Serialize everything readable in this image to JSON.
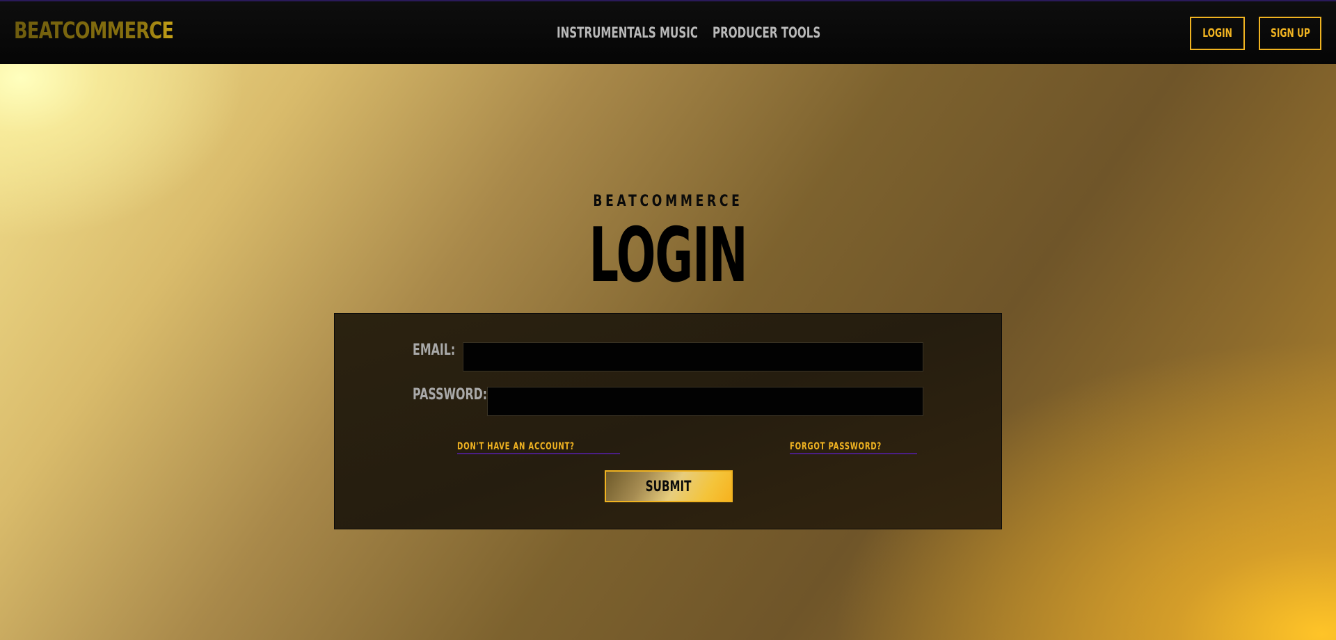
{
  "navbar": {
    "logo": "BEATCOMMERCE",
    "links": [
      "INSTRUMENTALS",
      "MUSIC",
      "PRODUCER TOOLS"
    ],
    "login_label": "LOGIN",
    "signup_label": "SIGN UP"
  },
  "hero": {
    "brand": "BEATCOMMERCE",
    "title": "LOGIN"
  },
  "form": {
    "email_label": "EMAIL:",
    "email_value": "",
    "password_label": "PASSWORD:",
    "password_value": "",
    "no_account_link": "DON'T HAVE AN ACCOUNT?",
    "forgot_link": "FORGOT PASSWORD?",
    "submit_label": "SUBMIT"
  },
  "colors": {
    "accent": "#f0b321",
    "link_underline": "#4b1f86",
    "panel_bg": "#2b2210",
    "nav_bg": "#0a0a0a"
  }
}
